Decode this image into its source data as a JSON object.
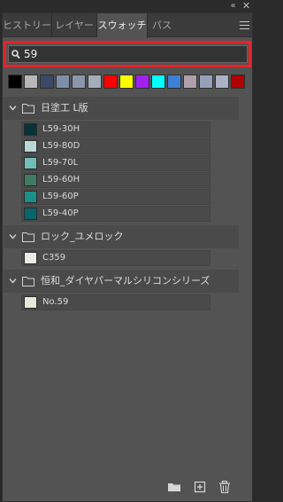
{
  "tabs": {
    "history": "ヒストリー",
    "layers": "レイヤー",
    "swatches": "スウォッチ",
    "paths": "パス"
  },
  "search": {
    "value": "59"
  },
  "recent_colors": [
    "#000000",
    "#b8b8b8",
    "#3a4866",
    "#7d8fa8",
    "#8a96aa",
    "#a5adba",
    "#ff0000",
    "#ffff00",
    "#a020f0",
    "#00ffff",
    "#3d7fd6",
    "#b0a0ab",
    "#96a0b8",
    "#aab2c4",
    "#b00000"
  ],
  "groups": [
    {
      "name": "日塗工 L版",
      "swatches": [
        {
          "name": "L59-30H",
          "color": "#063339"
        },
        {
          "name": "L59-80D",
          "color": "#b8d8d8"
        },
        {
          "name": "L59-70L",
          "color": "#6fbfb8"
        },
        {
          "name": "L59-60H",
          "color": "#3f7a63"
        },
        {
          "name": "L59-60P",
          "color": "#1b8f8a"
        },
        {
          "name": "L59-40P",
          "color": "#06646b"
        }
      ]
    },
    {
      "name": "ロック_ユメロック",
      "swatches": [
        {
          "name": "C359",
          "color": "#e9ede6"
        }
      ]
    },
    {
      "name": "恒和_ダイヤパーマルシリコンシリーズ",
      "swatches": [
        {
          "name": "No.59",
          "color": "#e6e8da"
        }
      ]
    }
  ]
}
